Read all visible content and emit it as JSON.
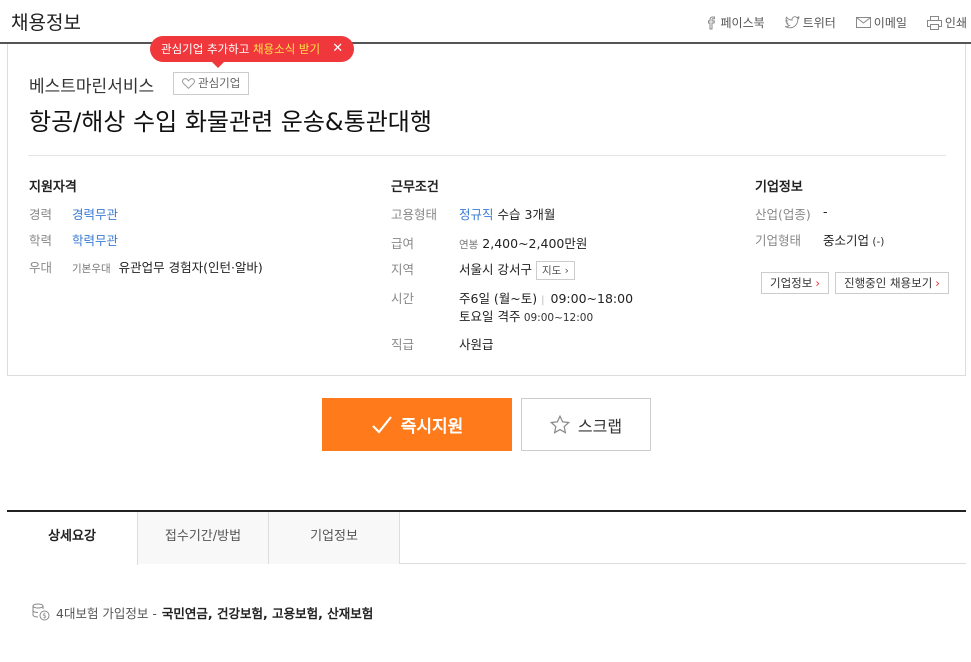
{
  "header": {
    "title": "채용정보",
    "share": [
      {
        "label": "페이스북",
        "icon": "facebook-icon"
      },
      {
        "label": "트위터",
        "icon": "twitter-icon"
      },
      {
        "label": "이메일",
        "icon": "mail-icon"
      },
      {
        "label": "인쇄",
        "icon": "print-icon"
      }
    ]
  },
  "tooltip": {
    "text_a": "관심기업 추가하고 ",
    "text_b": "채용소식 받기",
    "close": "✕"
  },
  "company": {
    "name": "베스트마린서비스",
    "fav_label": "관심기업"
  },
  "job_title": "항공/해상 수입 화물관련 운송&통관대행",
  "qualifications": {
    "heading": "지원자격",
    "experience_label": "경력",
    "experience_value": "경력무관",
    "education_label": "학력",
    "education_value": "학력무관",
    "preference_label": "우대",
    "preference_sub": "기본우대",
    "preference_value": "유관업무 경험자(인턴·알바)"
  },
  "conditions": {
    "heading": "근무조건",
    "type_label": "고용형태",
    "type_value": "정규직",
    "type_extra": " 수습 3개월",
    "salary_label": "급여",
    "salary_sub": "연봉",
    "salary_value": " 2,400~2,400만원",
    "location_label": "지역",
    "location_value": "서울시 강서구",
    "map_label": "지도 ›",
    "time_label": "시간",
    "time_days": "주6일 (월~토)",
    "time_sep": "|",
    "time_hours": "09:00~18:00",
    "time_sat": "토요일 격주",
    "time_sat_hours": " 09:00~12:00",
    "rank_label": "직급",
    "rank_value": "사원급"
  },
  "company_info": {
    "heading": "기업정보",
    "industry_label": "산업(업종)",
    "industry_value": "-",
    "form_label": "기업형태",
    "form_value": "중소기업",
    "form_extra": " (-)",
    "btn_info": "기업정보",
    "btn_jobs": "진행중인 채용보기"
  },
  "actions": {
    "apply": "즉시지원",
    "scrap": "스크랩"
  },
  "tabs": [
    {
      "label": "상세요강",
      "active": true
    },
    {
      "label": "접수기간/방법",
      "active": false
    },
    {
      "label": "기업정보",
      "active": false
    }
  ],
  "insurance": {
    "label": "4대보험 가입정보 - ",
    "value": "국민연금, 건강보험, 고용보험, 산재보험"
  },
  "colors": {
    "accent": "#ff7a1a",
    "link": "#3a7bd5",
    "tooltip": "#f0383c"
  }
}
